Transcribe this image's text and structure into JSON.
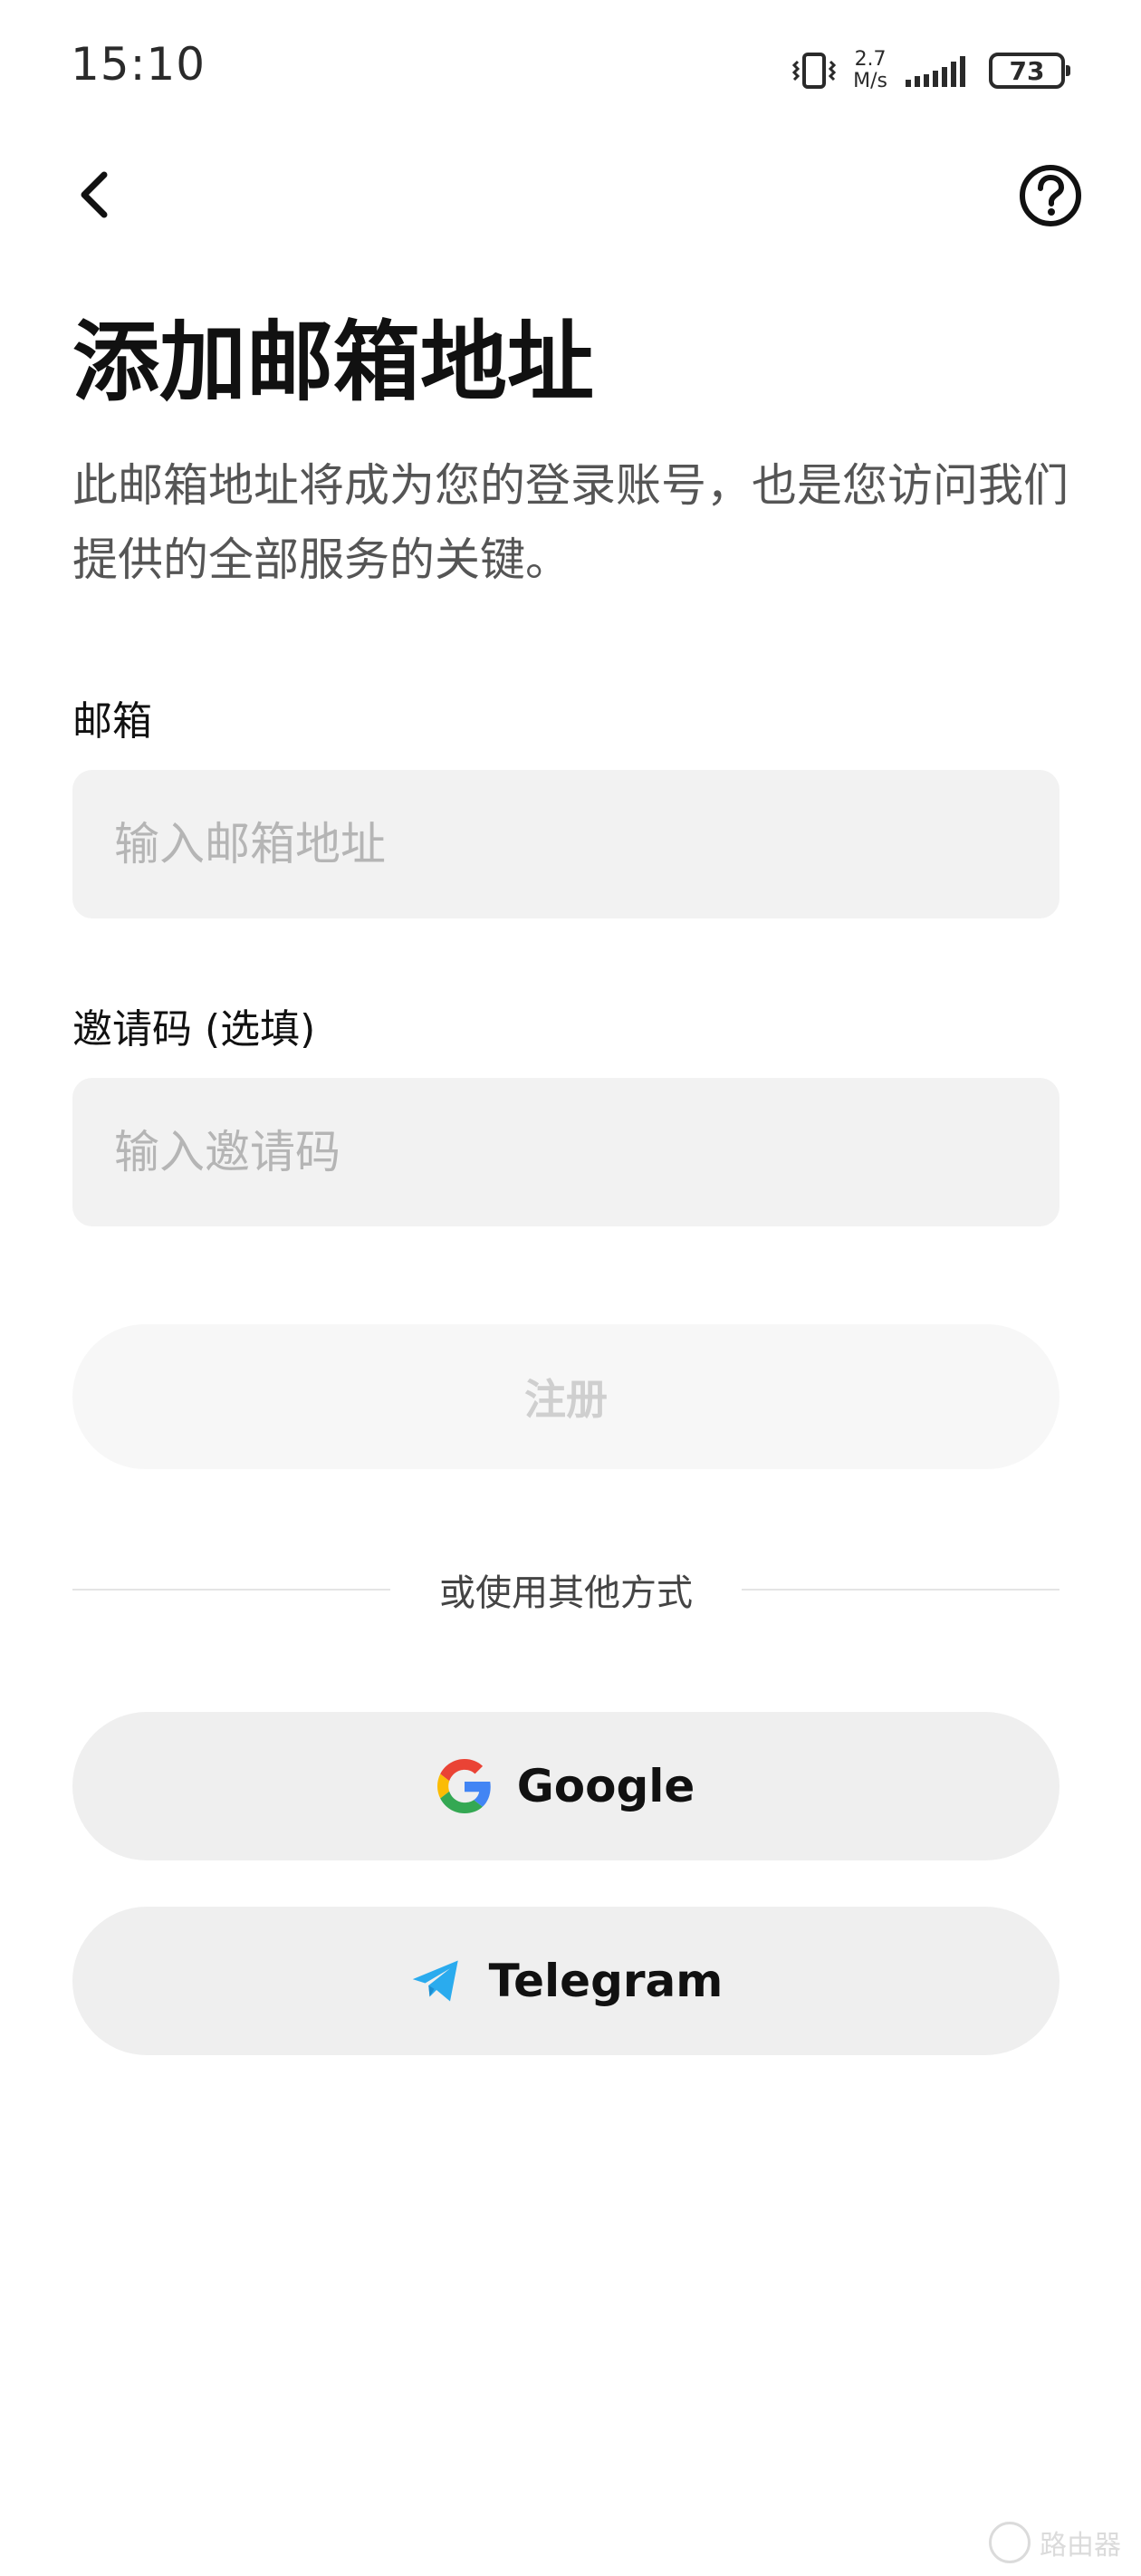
{
  "status_bar": {
    "time": "15:10",
    "net_speed_value": "2.7",
    "net_speed_unit": "M/s",
    "battery": "73"
  },
  "page": {
    "title": "添加邮箱地址",
    "subtitle": "此邮箱地址将成为您的登录账号，也是您访问我们提供的全部服务的关键。"
  },
  "form": {
    "email_label": "邮箱",
    "email_placeholder": "输入邮箱地址",
    "email_value": "",
    "invite_label": "邀请码 (选填)",
    "invite_placeholder": "输入邀请码",
    "invite_value": "",
    "register_label": "注册"
  },
  "divider": {
    "text": "或使用其他方式"
  },
  "social": {
    "google_label": "Google",
    "telegram_label": "Telegram"
  },
  "colors": {
    "google_blue": "#4285F4",
    "google_red": "#EA4335",
    "google_yellow": "#FBBC05",
    "google_green": "#34A853",
    "telegram_blue": "#2AABEE"
  },
  "watermark": {
    "text": "路由器"
  }
}
